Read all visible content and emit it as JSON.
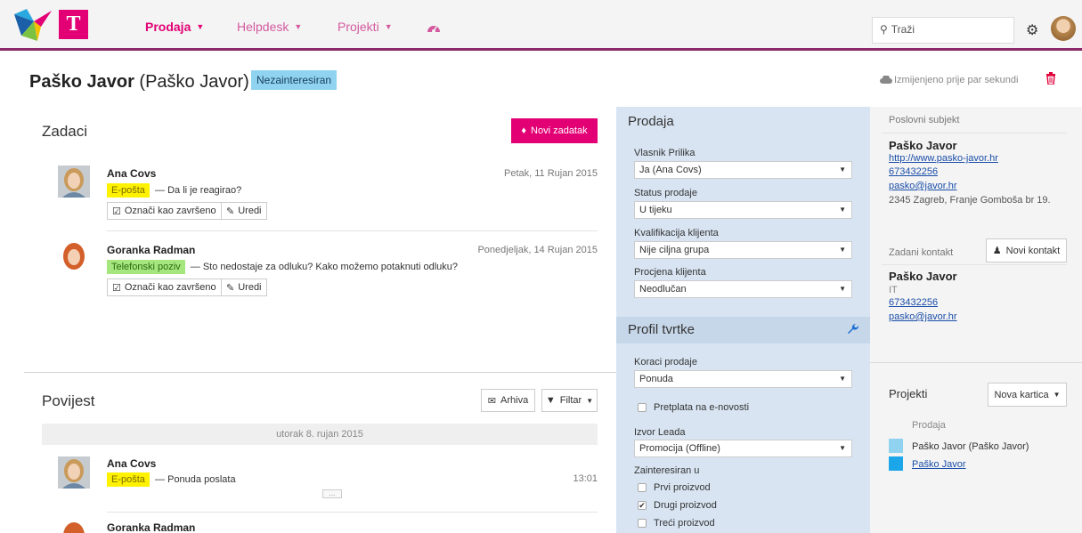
{
  "nav": {
    "logo_letter": "T",
    "items": [
      {
        "label": "Prodaja",
        "active": true
      },
      {
        "label": "Helpdesk",
        "active": false
      },
      {
        "label": "Projekti",
        "active": false
      }
    ],
    "search_placeholder": "Traži"
  },
  "header": {
    "name_bold": "Paško Javor",
    "name_paren": "(Paško Javor)",
    "status_badge": "Nezainteresiran",
    "modified": "Izmijenjeno prije par sekundi"
  },
  "tasks": {
    "title": "Zadaci",
    "new_button": "Novi zadatak",
    "mark_done_label": "Označi kao završeno",
    "edit_label": "Uredi",
    "items": [
      {
        "name": "Ana Covs",
        "date": "Petak, 11 Rujan 2015",
        "tag": "E-pošta",
        "text": "— Da li je reagirao?"
      },
      {
        "name": "Goranka Radman",
        "date": "Ponedjeljak, 14 Rujan 2015",
        "tag": "Telefonski poziv",
        "text": "— Sto nedostaje za odluku? Kako možemo potaknuti odluku?"
      }
    ]
  },
  "history": {
    "title": "Povijest",
    "archive_button": "Arhiva",
    "filter_button": "Filtar",
    "date_divider": "utorak 8. rujan 2015",
    "items": [
      {
        "name": "Ana Covs",
        "tag": "E-pošta",
        "text": "— Ponuda poslata",
        "time": "13:01",
        "more": "..."
      },
      {
        "name": "Goranka Radman"
      }
    ]
  },
  "sales": {
    "title": "Prodaja",
    "fields": [
      {
        "label": "Vlasnik Prilika",
        "value": "Ja (Ana Covs)"
      },
      {
        "label": "Status prodaje",
        "value": "U tijeku"
      },
      {
        "label": "Kvalifikacija klijenta",
        "value": "Nije ciljna grupa"
      },
      {
        "label": "Procjena klijenta",
        "value": "Neodlučan"
      }
    ]
  },
  "profile": {
    "title": "Profil tvrtke",
    "steps_label": "Koraci prodaje",
    "steps_value": "Ponuda",
    "newsletter_label": "Pretplata na e-novosti",
    "newsletter_checked": false,
    "lead_label": "Izvor Leada",
    "lead_value": "Promocija (Offline)",
    "interest_label": "Zainteresiran u",
    "interests": [
      {
        "label": "Prvi proizvod",
        "checked": false
      },
      {
        "label": "Drugi proizvod",
        "checked": true
      },
      {
        "label": "Treći proizvod",
        "checked": false
      }
    ]
  },
  "company": {
    "label": "Poslovni subjekt",
    "name": "Paško Javor",
    "url": "http://www.pasko-javor.hr",
    "phone": "673432256",
    "email": "pasko@javor.hr",
    "address": "2345 Zagreb, Franje Gomboša br 19."
  },
  "contact": {
    "label": "Zadani kontakt",
    "new_button": "Novi kontakt",
    "name": "Paško Javor",
    "role": "IT",
    "phone": "673432256",
    "email": "pasko@javor.hr"
  },
  "projects": {
    "title": "Projekti",
    "new_button": "Nova kartica",
    "group_label": "Prodaja",
    "items": [
      {
        "label": "Paško Javor (Paško Javor)",
        "color": "#8fd3f0"
      },
      {
        "label": "Paško Javor",
        "color": "#1aa6e8"
      }
    ]
  },
  "colors": {
    "brand": "#e20074",
    "badge": "#8fd3f0"
  }
}
